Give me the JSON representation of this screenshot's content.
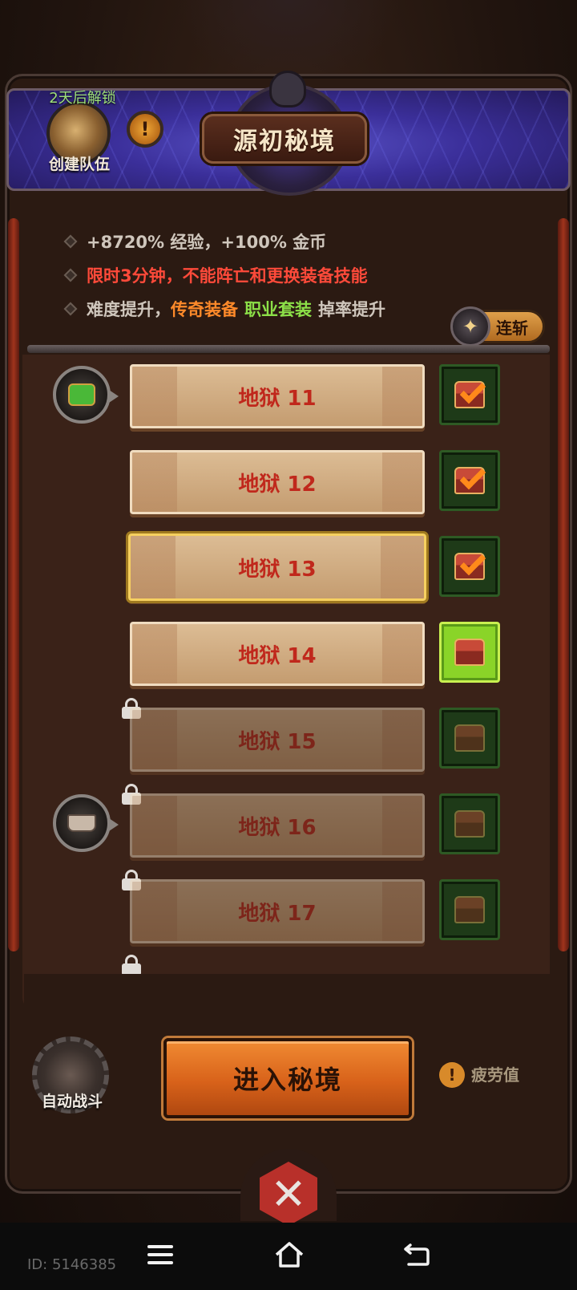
{
  "header": {
    "title": "源初秘境",
    "unlock_text": "2天后解锁",
    "team_label": "创建队伍",
    "info_glyph": "!"
  },
  "description": {
    "line1": "+8720% 经验，+100% 金币",
    "line2": "限时3分钟，不能阵亡和更换装备技能",
    "line3_prefix": "难度提升，",
    "line3_legend": "传奇装备",
    "line3_set": "职业套装",
    "line3_suffix": "掉率提升"
  },
  "combo_button": {
    "label": "连斩",
    "icon": "star-icon"
  },
  "levels": [
    {
      "label": "地狱 11",
      "state": "completed",
      "reward": "armor-icon"
    },
    {
      "label": "地狱 12",
      "state": "completed"
    },
    {
      "label": "地狱 13",
      "state": "completed",
      "selected": true
    },
    {
      "label": "地狱 14",
      "state": "available"
    },
    {
      "label": "地狱 15",
      "state": "locked"
    },
    {
      "label": "地狱 16",
      "state": "locked",
      "reward": "anvil-icon"
    },
    {
      "label": "地狱 17",
      "state": "locked"
    }
  ],
  "bottom": {
    "auto_battle_label": "自动战斗",
    "enter_button": "进入秘境",
    "fatigue_label": "疲劳值",
    "fatigue_glyph": "!",
    "close_glyph": "✕"
  },
  "system": {
    "game_id": "ID: 5146385"
  },
  "colors": {
    "accent_red": "#ff4a3a",
    "accent_orange": "#ff8a2a",
    "accent_green": "#8ce048",
    "button_orange": "#d8621a"
  }
}
